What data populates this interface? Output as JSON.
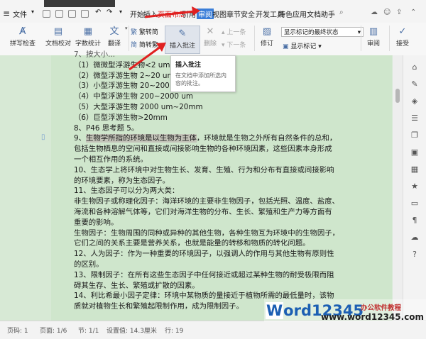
{
  "menu": {
    "file": "文件",
    "tabs": [
      "开始",
      "插入",
      "页面布局",
      "引用",
      "审阅",
      "视图",
      "章节",
      "安全",
      "开发工具",
      "特色应用",
      "文档助手"
    ],
    "active_tab": "审阅"
  },
  "ribbon": {
    "spell_check": "拼写检查",
    "doc_proof": "文档校对",
    "word_count": "字数统计",
    "translate": "翻译",
    "trad_to_simp": "繁转简",
    "simp_to_trad": "简转繁",
    "insert_comment": "插入批注",
    "delete": "删除",
    "prev": "上一条",
    "next": "下一条",
    "revise": "修订",
    "display_mode": "显示标记的最终状态",
    "show_markup": "显示标记",
    "review": "审阅",
    "accept": "接受"
  },
  "tooltip": {
    "title": "插入批注",
    "desc": "在文档中添加所选内容的批注。"
  },
  "document": {
    "lines": [
      "7、按大小...",
      "（1）微微型浮游生物<2 um",
      "（2）微型浮游生物 2~20 um",
      "（3）小型浮游生物 20~200 um",
      "（4）中型浮游生物 200~2000 um",
      "（5）大型浮游生物 2000 um~20mm",
      "（6）巨型浮游生物>20mm",
      "8、P46 思考题 5。",
      "9、生物学所指的环境是以生物为主体，环境就是生物之外所有自然条件的总和，",
      "包括生物栖息的空间和直接或间接影响生物的各种环境因素，这些因素本身形成",
      "一个相互作用的系统。",
      "10、生态学上将环境中对生物生长、发育、生殖、行为和分布有直接或间接影响",
      "的环境要素，称为生态因子。",
      "11、生态因子可以分为两大类：",
      "非生物因子或称理化因子：海洋环境的主要非生物因子，包括光照、温度、盐度、",
      "海流和各种溶解气体等，它们对海洋生物的分布、生长、繁殖和生产力等方面有",
      "重要的影响。",
      "生物因子：生物周围的同种或异种的其他生物，各种生物互为环境中的生物因子，",
      "它们之间的关系主要是营养关系，也就是能量的转移和物质的转化问题。",
      "12、人为因子：作为一种重要的环境因子，以强调人的作用与其他生物有原则性",
      "的区别。",
      "13、限制因子：在所有这些生态因子中任何接近或超过某种生物的耐受极限而阻",
      "碍其生存、生长、繁殖或扩散的因素。",
      "14、利比希最小因子定律：环境中某物质的量接近于植物所需的最低量时，该物",
      "质就对植物生长和繁殖起限制作用，成为限制因子。"
    ],
    "selected_text": "生物学所指的环境是以生物为主体"
  },
  "status": {
    "page": "页码: 1",
    "pages": "页面: 1/6",
    "section": "节: 1/1",
    "setting": "设置值: 14.3厘米",
    "row": "行: 19"
  },
  "watermark": {
    "logo_w": "W",
    "logo_rest": "ord12345",
    "tagline": "办公软件教程",
    "url": "www.word12345.com"
  },
  "colors": {
    "active_tab": "#3b7ed8",
    "document_bg": "#cfe6cc",
    "arrow": "#e02020"
  }
}
